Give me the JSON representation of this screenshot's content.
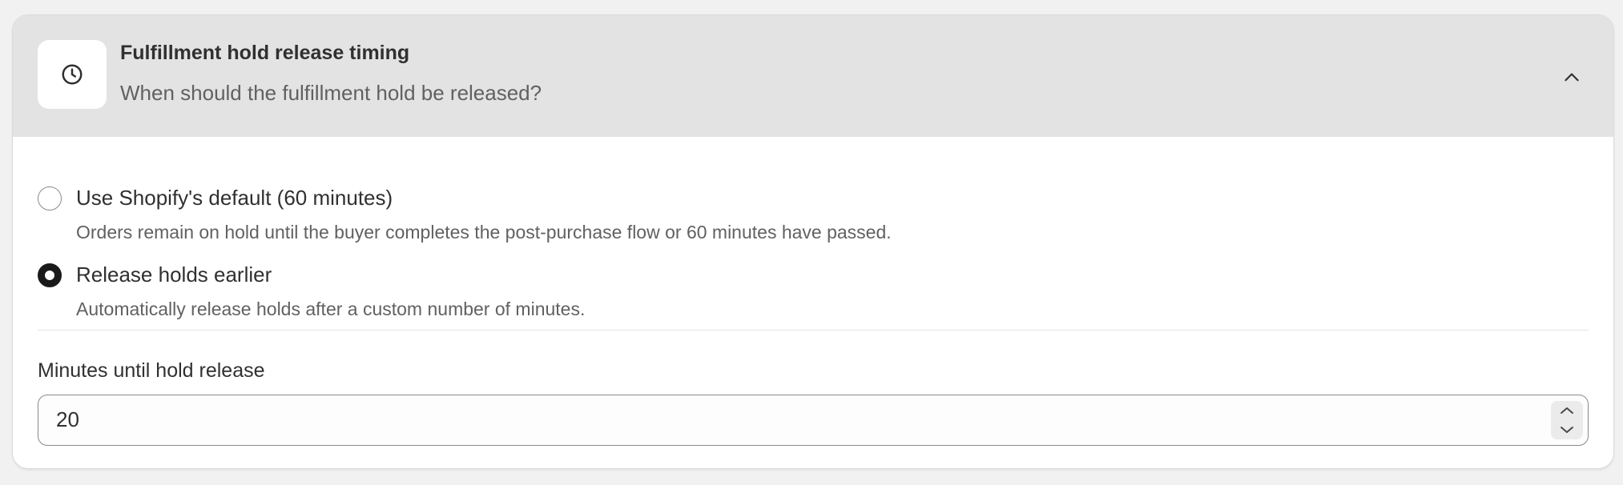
{
  "section": {
    "title": "Fulfillment hold release timing",
    "subtitle": "When should the fulfillment hold be released?",
    "header_icon": "clock-icon",
    "collapse_icon": "chevron-up-icon",
    "expanded": true
  },
  "options": [
    {
      "label": "Use Shopify's default (60 minutes)",
      "help": "Orders remain on hold until the buyer completes the post-purchase flow or 60 minutes have passed.",
      "selected": false
    },
    {
      "label": "Release holds earlier",
      "help": "Automatically release holds after a custom number of minutes.",
      "selected": true
    }
  ],
  "minutes_field": {
    "label": "Minutes until hold release",
    "value": "20",
    "increment_icon": "chevron-up-icon",
    "decrement_icon": "chevron-down-icon"
  },
  "colors": {
    "header_bg": "#e3e3e3",
    "page_bg": "#f1f1f1",
    "text_primary": "#303030",
    "text_secondary": "#616161",
    "radio_selected": "#1a1a1a"
  }
}
